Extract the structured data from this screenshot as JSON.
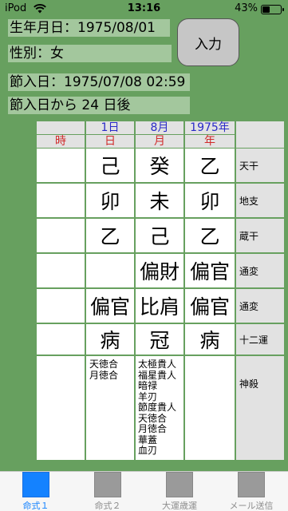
{
  "status_bar": {
    "carrier": "iPod",
    "time": "13:16",
    "battery_pct": "43%",
    "battery_level": 0.43
  },
  "info": {
    "birth_date": "生年月日：1975/08/01",
    "gender": "性別：女",
    "setsuiri_date": "節入日：1975/07/08 02:59",
    "days_after": "節入日から 24 日後",
    "input_button": "入力"
  },
  "chart": {
    "dates": {
      "day": "1日",
      "month": "8月",
      "year": "1975年"
    },
    "pillars": {
      "hour": "時",
      "day": "日",
      "month": "月",
      "year": "年"
    },
    "rows": [
      {
        "label": "天干",
        "hour": "",
        "day": "己",
        "month": "癸",
        "year": "乙"
      },
      {
        "label": "地支",
        "hour": "",
        "day": "卯",
        "month": "未",
        "year": "卯"
      },
      {
        "label": "蔵干",
        "hour": "",
        "day": "乙",
        "month": "己",
        "year": "乙"
      },
      {
        "label": "通変",
        "hour": "",
        "day": "",
        "month": "偏財",
        "year": "偏官"
      },
      {
        "label": "通変",
        "hour": "",
        "day": "偏官",
        "month": "比肩",
        "year": "偏官"
      },
      {
        "label": "十二運",
        "hour": "",
        "day": "病",
        "month": "冠",
        "year": "病"
      }
    ],
    "shinsatsu_label": "神殺",
    "shinsatsu_day": [
      "天徳合",
      "月徳合"
    ],
    "shinsatsu_month": [
      "太極貴人",
      "福星貴人",
      "暗禄",
      "羊刃",
      "節度貴人",
      "天徳合",
      "月徳合",
      "華蓋",
      "血刃"
    ]
  },
  "tabs": [
    {
      "label": "命式１",
      "active": true
    },
    {
      "label": "命式２",
      "active": false
    },
    {
      "label": "大運歳運",
      "active": false
    },
    {
      "label": "メール送信",
      "active": false
    }
  ]
}
